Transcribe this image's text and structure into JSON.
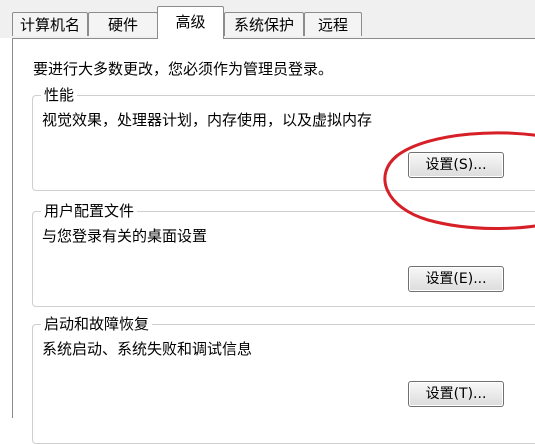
{
  "tabs": [
    {
      "label": "计算机名"
    },
    {
      "label": "硬件"
    },
    {
      "label": "高级"
    },
    {
      "label": "系统保护"
    },
    {
      "label": "远程"
    }
  ],
  "admin_notice": "要进行大多数更改，您必须作为管理员登录。",
  "performance": {
    "title": "性能",
    "description": "视觉效果，处理器计划，内存使用，以及虚拟内存",
    "button": "设置(S)..."
  },
  "user_profiles": {
    "title": "用户配置文件",
    "description": "与您登录有关的桌面设置",
    "button": "设置(E)..."
  },
  "startup_recovery": {
    "title": "启动和故障恢复",
    "description": "系统启动、系统失败和调试信息",
    "button": "设置(T)..."
  },
  "colors": {
    "annotation": "#d61f26",
    "border": "#8c8c8c"
  }
}
